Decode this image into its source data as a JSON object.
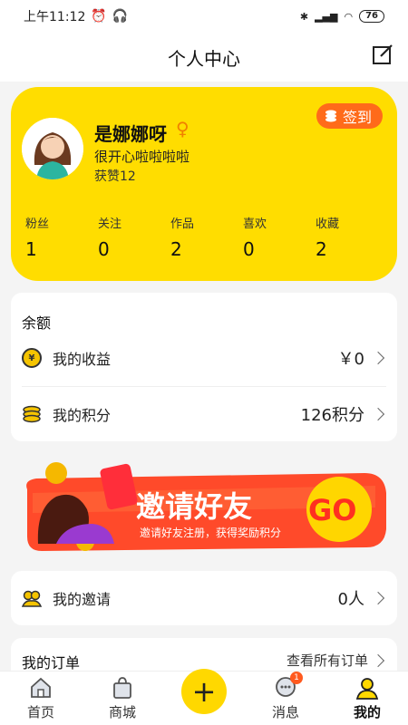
{
  "statusbar": {
    "time": "上午11:12",
    "battery": "76"
  },
  "header": {
    "title": "个人中心"
  },
  "profile": {
    "username": "是娜娜呀",
    "gender_symbol": "♀",
    "bio": "很开心啦啦啦啦",
    "likes": "获赞12",
    "checkin_label": "签到",
    "stats": [
      {
        "label": "粉丝",
        "value": "1"
      },
      {
        "label": "关注",
        "value": "0"
      },
      {
        "label": "作品",
        "value": "2"
      },
      {
        "label": "喜欢",
        "value": "0"
      },
      {
        "label": "收藏",
        "value": "2"
      }
    ]
  },
  "balance": {
    "title": "余额",
    "earnings_label": "我的收益",
    "earnings_value": "￥0",
    "points_label": "我的积分",
    "points_value": "126积分"
  },
  "banner": {
    "title": "邀请好友",
    "subtitle": "邀请好友注册，获得奖励积分",
    "go": "GO"
  },
  "invite": {
    "label": "我的邀请",
    "value": "0人"
  },
  "orders": {
    "title": "我的订单",
    "view_all": "查看所有订单"
  },
  "tabbar": {
    "home": "首页",
    "mall": "商城",
    "messages": "消息",
    "messages_badge": "1",
    "mine": "我的"
  },
  "colors": {
    "accent": "#ffdd00",
    "checkin": "#ff6b1a",
    "banner": "#ff4a2a"
  }
}
